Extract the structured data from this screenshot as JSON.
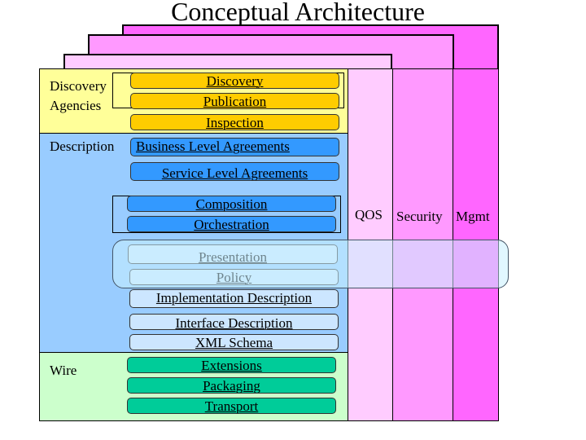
{
  "title": "Conceptual Architecture",
  "colors": {
    "mgmt": "#ff66ff",
    "security": "#ff99ff",
    "qos": "#ffccff",
    "discovery_section": "#ffff99",
    "description_section": "#99ccff",
    "wire_section": "#ccffcc",
    "discovery_box": "#ffcc00",
    "description_box": "#3399ff",
    "description_pale_box": "#cce6ff",
    "wire_box": "#00cc99"
  },
  "vertical_layers": [
    {
      "id": "qos",
      "label": "QOS"
    },
    {
      "id": "security",
      "label": "Security"
    },
    {
      "id": "mgmt",
      "label": "Mgmt"
    }
  ],
  "sections": {
    "discovery": {
      "label_line1": "Discovery",
      "label_line2": "Agencies",
      "boxes": [
        "Discovery",
        "Publication",
        "Inspection"
      ]
    },
    "description": {
      "label": "Description",
      "boxes": [
        "Business Level Agreements",
        "Service Level Agreements",
        "Composition",
        "Orchestration",
        "Presentation",
        "Policy",
        "Implementation Description",
        "Interface Description",
        "XML Schema"
      ]
    },
    "wire": {
      "label": "Wire",
      "boxes": [
        "Extensions",
        "Packaging",
        "Transport"
      ]
    }
  }
}
